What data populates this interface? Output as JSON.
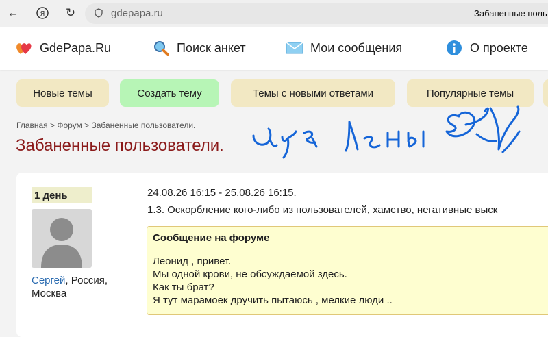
{
  "browser": {
    "url": "gdepapa.ru",
    "tab_title": "Забаненные поль"
  },
  "header": {
    "site_name": "GdePapa.Ru",
    "nav": [
      {
        "label": "Поиск анкет",
        "icon": "magnifier-icon"
      },
      {
        "label": "Мои сообщения",
        "icon": "envelope-icon"
      },
      {
        "label": "О проекте",
        "icon": "info-icon"
      }
    ]
  },
  "tabs": [
    {
      "label": "Новые темы"
    },
    {
      "label": "Создать тему"
    },
    {
      "label": "Темы с новыми ответами"
    },
    {
      "label": "Популярные темы"
    }
  ],
  "breadcrumb": "Главная > Форум > Забаненные пользователи.",
  "page_title": "Забаненные пользователи.",
  "ban_entry": {
    "duration": "1 день",
    "author_name": "Сергей",
    "author_location": ", Россия, Москва",
    "period": "24.08.26 16:15 - 25.08.26 16:15.",
    "reason": "1.3. Оскорбление кого-либо из пользователей, хамство, негативные выск",
    "message": {
      "heading": "Сообщение на форуме",
      "lines": [
        "Леонид , привет.",
        "Мы одной крови, не обсуждаемой здесь.",
        "Как ты брат?",
        "Я тут марамоек дручить пытаюсь , мелкие люди .."
      ]
    }
  },
  "colors": {
    "tab_default": "#f2e8c3",
    "tab_create": "#b7f5b6",
    "title_red": "#8b1a1a",
    "link_blue": "#2a6bb0",
    "scribble_blue": "#1565d8",
    "message_bg": "#fefed0"
  }
}
